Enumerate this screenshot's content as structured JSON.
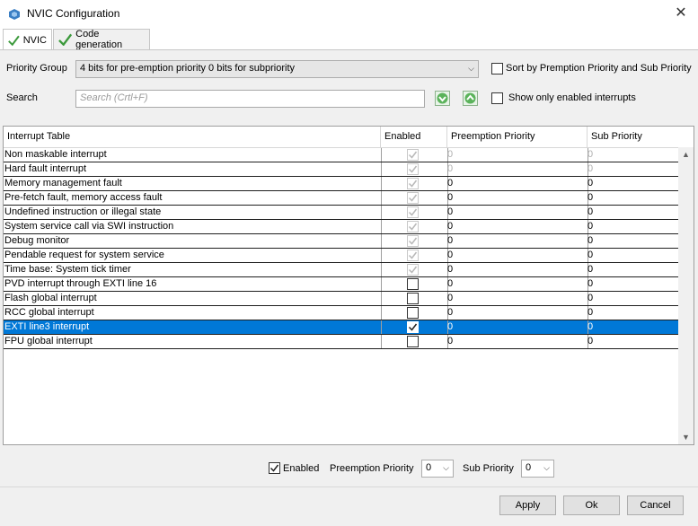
{
  "window": {
    "title": "NVIC Configuration",
    "close_glyph": "✕"
  },
  "tabs": [
    {
      "label": "NVIC",
      "active": true,
      "icon": "check-icon"
    },
    {
      "label": "Code generation",
      "active": false,
      "icon": "check-icon"
    }
  ],
  "controls": {
    "priority_group_label": "Priority Group",
    "priority_group_value": "4 bits for pre-emption priority 0 bits for subpriority",
    "sort_label": "Sort by Premption Priority and Sub Priority",
    "search_label": "Search",
    "search_placeholder": "Search (Crtl+F)",
    "show_enabled_label": "Show only enabled interrupts"
  },
  "table": {
    "headers": [
      "Interrupt Table",
      "Enabled",
      "Preemption Priority",
      "Sub Priority"
    ],
    "rows": [
      {
        "name": "Non maskable interrupt",
        "enabled": true,
        "locked": true,
        "preemption": "0",
        "sub": "0",
        "dim_values": true
      },
      {
        "name": "Hard fault interrupt",
        "enabled": true,
        "locked": true,
        "preemption": "0",
        "sub": "0",
        "dim_values": true
      },
      {
        "name": "Memory management fault",
        "enabled": true,
        "locked": true,
        "preemption": "0",
        "sub": "0"
      },
      {
        "name": "Pre-fetch fault, memory access fault",
        "enabled": true,
        "locked": true,
        "preemption": "0",
        "sub": "0"
      },
      {
        "name": "Undefined instruction or illegal state",
        "enabled": true,
        "locked": true,
        "preemption": "0",
        "sub": "0"
      },
      {
        "name": "System service call via SWI instruction",
        "enabled": true,
        "locked": true,
        "preemption": "0",
        "sub": "0"
      },
      {
        "name": "Debug monitor",
        "enabled": true,
        "locked": true,
        "preemption": "0",
        "sub": "0"
      },
      {
        "name": "Pendable request for system service",
        "enabled": true,
        "locked": true,
        "preemption": "0",
        "sub": "0"
      },
      {
        "name": "Time base: System tick timer",
        "enabled": true,
        "locked": true,
        "preemption": "0",
        "sub": "0"
      },
      {
        "name": "PVD interrupt through EXTI line 16",
        "enabled": false,
        "locked": false,
        "preemption": "0",
        "sub": "0"
      },
      {
        "name": "Flash global interrupt",
        "enabled": false,
        "locked": false,
        "preemption": "0",
        "sub": "0"
      },
      {
        "name": "RCC global interrupt",
        "enabled": false,
        "locked": false,
        "preemption": "0",
        "sub": "0"
      },
      {
        "name": "EXTI line3 interrupt",
        "enabled": true,
        "locked": false,
        "preemption": "0",
        "sub": "0",
        "selected": true
      },
      {
        "name": "FPU global interrupt",
        "enabled": false,
        "locked": false,
        "preemption": "0",
        "sub": "0"
      }
    ]
  },
  "editor": {
    "enabled_label": "Enabled",
    "enabled_checked": true,
    "preemption_label": "Preemption Priority",
    "preemption_value": "0",
    "sub_label": "Sub Priority",
    "sub_value": "0"
  },
  "buttons": {
    "apply": "Apply",
    "ok": "Ok",
    "cancel": "Cancel"
  },
  "colors": {
    "selection": "#0078d7",
    "accent_green": "#3c9a3c"
  }
}
